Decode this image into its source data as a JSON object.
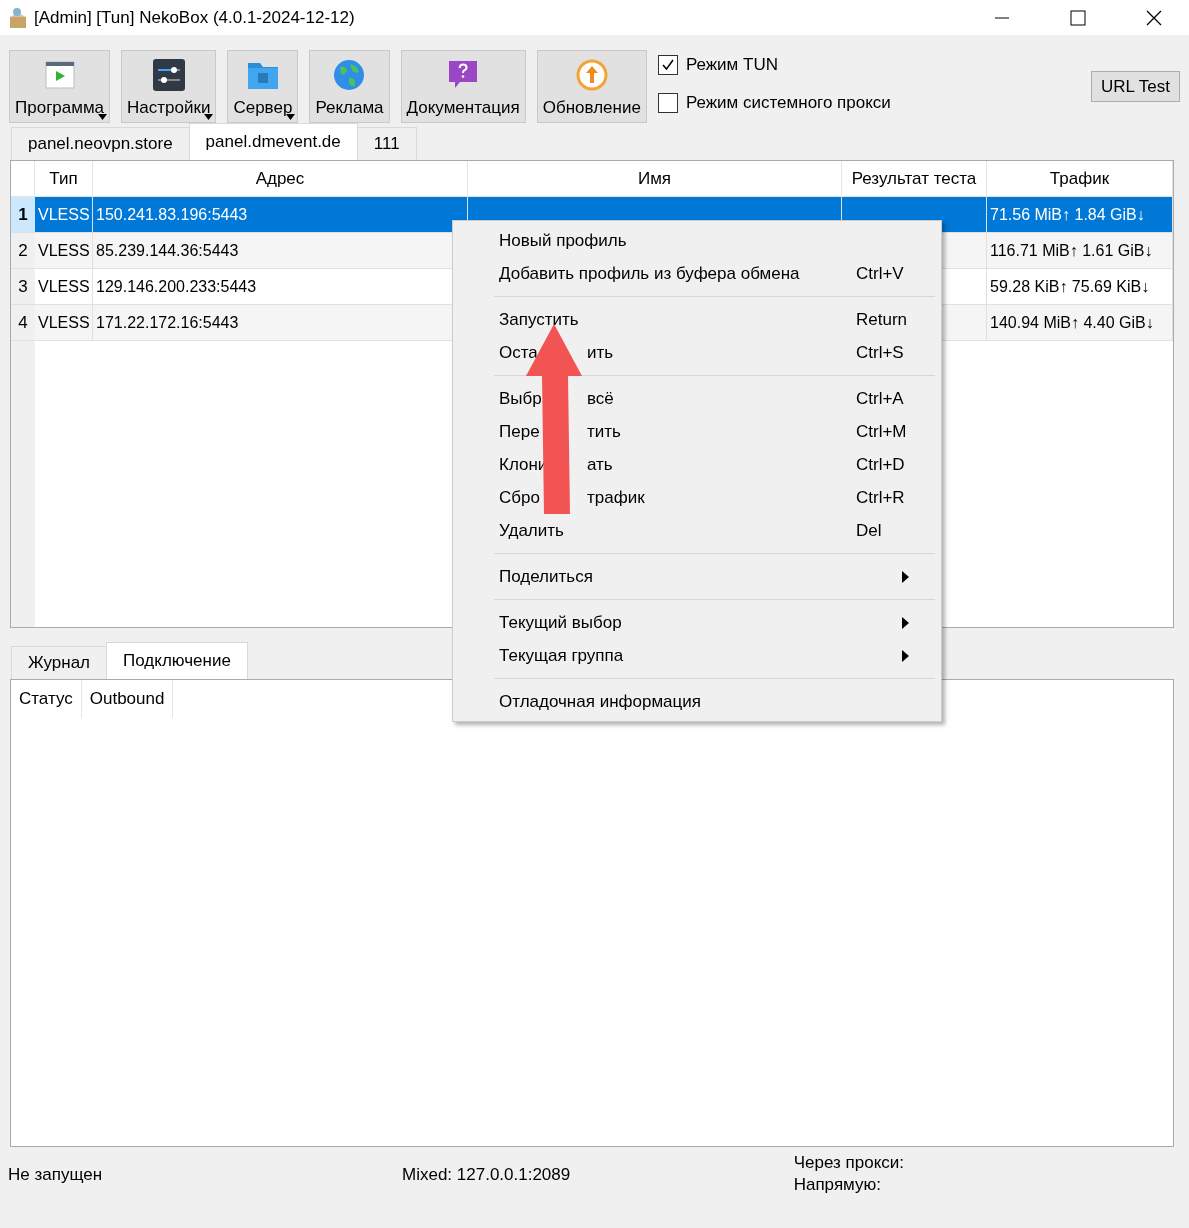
{
  "window": {
    "title": "[Admin] [Tun] NekoBox (4.0.1-2024-12-12)"
  },
  "toolbar": [
    {
      "label": "Программа",
      "has_menu": true
    },
    {
      "label": "Настройки",
      "has_menu": true
    },
    {
      "label": "Сервер",
      "has_menu": true
    },
    {
      "label": "Реклама",
      "has_menu": false
    },
    {
      "label": "Документация",
      "has_menu": false
    },
    {
      "label": "Обновление",
      "has_menu": false
    }
  ],
  "modes": [
    {
      "label": "Режим TUN",
      "checked": true
    },
    {
      "label": "Режим системного прокси",
      "checked": false
    }
  ],
  "url_test": "URL Test",
  "group_tabs": [
    {
      "label": "panel.neovpn.store",
      "selected": false
    },
    {
      "label": "panel.dmevent.de",
      "selected": true
    },
    {
      "label": "111",
      "selected": false
    }
  ],
  "table": {
    "columns": [
      "Тип",
      "Адрес",
      "Имя",
      "Результат теста",
      "Трафик"
    ],
    "rows": [
      {
        "index": "1",
        "selected": true,
        "type": "VLESS",
        "address": "150.241.83.196:5443",
        "traffic": "71.56 MiB↑ 1.84 GiB↓"
      },
      {
        "index": "2",
        "selected": false,
        "type": "VLESS",
        "address": "85.239.144.36:5443",
        "traffic": "116.71 MiB↑ 1.61 GiB↓"
      },
      {
        "index": "3",
        "selected": false,
        "type": "VLESS",
        "address": "129.146.200.233:5443",
        "traffic": "59.28 KiB↑ 75.69 KiB↓"
      },
      {
        "index": "4",
        "selected": false,
        "type": "VLESS",
        "address": "171.22.172.16:5443",
        "traffic": "140.94 MiB↑ 4.40 GiB↓"
      }
    ]
  },
  "context_menu": {
    "sections": [
      [
        {
          "label": "Новый профиль",
          "submenu": false
        },
        {
          "label": "Добавить профиль из буфера обмена",
          "shortcut": "Ctrl+V",
          "submenu": false
        }
      ],
      [
        {
          "label": "Запустить",
          "shortcut": "Return",
          "submenu": false
        },
        {
          "label": "Оста",
          "label_end": "ить",
          "shortcut": "Ctrl+S",
          "submenu": false
        }
      ],
      [
        {
          "label": "Выбр",
          "label_end": "всё",
          "shortcut": "Ctrl+A",
          "submenu": false
        },
        {
          "label": "Пере",
          "label_end": "тить",
          "shortcut": "Ctrl+M",
          "submenu": false
        },
        {
          "label": "Клони",
          "label_end": "ать",
          "shortcut": "Ctrl+D",
          "submenu": false
        },
        {
          "label": "Сбро",
          "label_end": "трафик",
          "shortcut": "Ctrl+R",
          "submenu": false
        },
        {
          "label": "Удалить",
          "shortcut": "Del",
          "submenu": false
        }
      ],
      [
        {
          "label": "Поделиться",
          "submenu": true
        }
      ],
      [
        {
          "label": "Текущий выбор",
          "submenu": true
        },
        {
          "label": "Текущая группа",
          "submenu": true
        }
      ],
      [
        {
          "label": "Отладочная информация",
          "submenu": false
        }
      ]
    ]
  },
  "bottom_tabs": [
    {
      "label": "Журнал",
      "selected": false
    },
    {
      "label": "Подключение",
      "selected": true
    }
  ],
  "connections_table": {
    "columns": [
      "Статус",
      "Outbound"
    ]
  },
  "status_bar": {
    "state": "Не запущен",
    "mixed": "Mixed: 127.0.0.1:2089",
    "via_proxy": "Через прокси:",
    "direct": "Напрямую:"
  }
}
